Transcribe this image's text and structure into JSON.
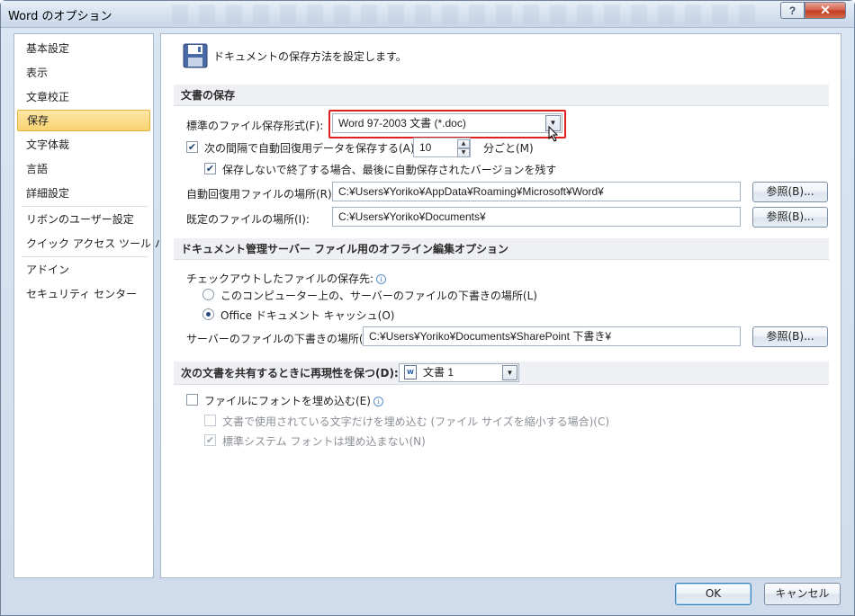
{
  "window": {
    "title": "Word のオプション",
    "help_symbol": "?",
    "close_symbol": "✕"
  },
  "nav": {
    "items": [
      "基本設定",
      "表示",
      "文章校正",
      "保存",
      "文字体裁",
      "言語",
      "詳細設定",
      "リボンのユーザー設定",
      "クイック アクセス ツール バー",
      "アドイン",
      "セキュリティ センター"
    ],
    "selected": "保存"
  },
  "header": {
    "text": "ドキュメントの保存方法を設定します。"
  },
  "save": {
    "section_title": "文書の保存",
    "format_label": "標準のファイル保存形式(F):",
    "format_value": "Word 97-2003 文書 (*.doc)",
    "autosave_label": "次の間隔で自動回復用データを保存する(A):",
    "autosave_checked": true,
    "autosave_minutes": "10",
    "autosave_unit": "分ごと(M)",
    "keep_last_label": "保存しないで終了する場合、最後に自動保存されたバージョンを残す",
    "keep_last_checked": true,
    "autorecover_label": "自動回復用ファイルの場所(R):",
    "autorecover_path": "C:¥Users¥Yoriko¥AppData¥Roaming¥Microsoft¥Word¥",
    "default_label": "既定のファイルの場所(I):",
    "default_path": "C:¥Users¥Yoriko¥Documents¥",
    "browse_label": "参照(B)..."
  },
  "offline": {
    "section_title": "ドキュメント管理サーバー ファイル用のオフライン編集オプション",
    "checkout_label": "チェックアウトしたファイルの保存先:",
    "option_server": "このコンピューター上の、サーバーのファイルの下書きの場所(L)",
    "option_cache": "Office ドキュメント キャッシュ(O)",
    "selected_option": "Office ドキュメント キャッシュ(O)",
    "drafts_label": "サーバーのファイルの下書きの場所(V):",
    "drafts_path": "C:¥Users¥Yoriko¥Documents¥SharePoint 下書き¥",
    "browse_label": "参照(B)..."
  },
  "fidelity": {
    "section_title": "次の文書を共有するときに再現性を保つ(D):",
    "document_value": "文書 1",
    "embed_fonts_label": "ファイルにフォントを埋め込む(E)",
    "embed_fonts_checked": false,
    "embed_used_label": "文書で使用されている文字だけを埋め込む (ファイル サイズを縮小する場合)(C)",
    "embed_used_checked": false,
    "no_system_label": "標準システム フォントは埋め込まない(N)",
    "no_system_checked": true
  },
  "footer": {
    "ok_label": "OK",
    "cancel_label": "キャンセル"
  },
  "colors": {
    "selected_nav": "#f8d36f",
    "highlight": "#e02020",
    "accent_blue": "#3c74c1"
  }
}
